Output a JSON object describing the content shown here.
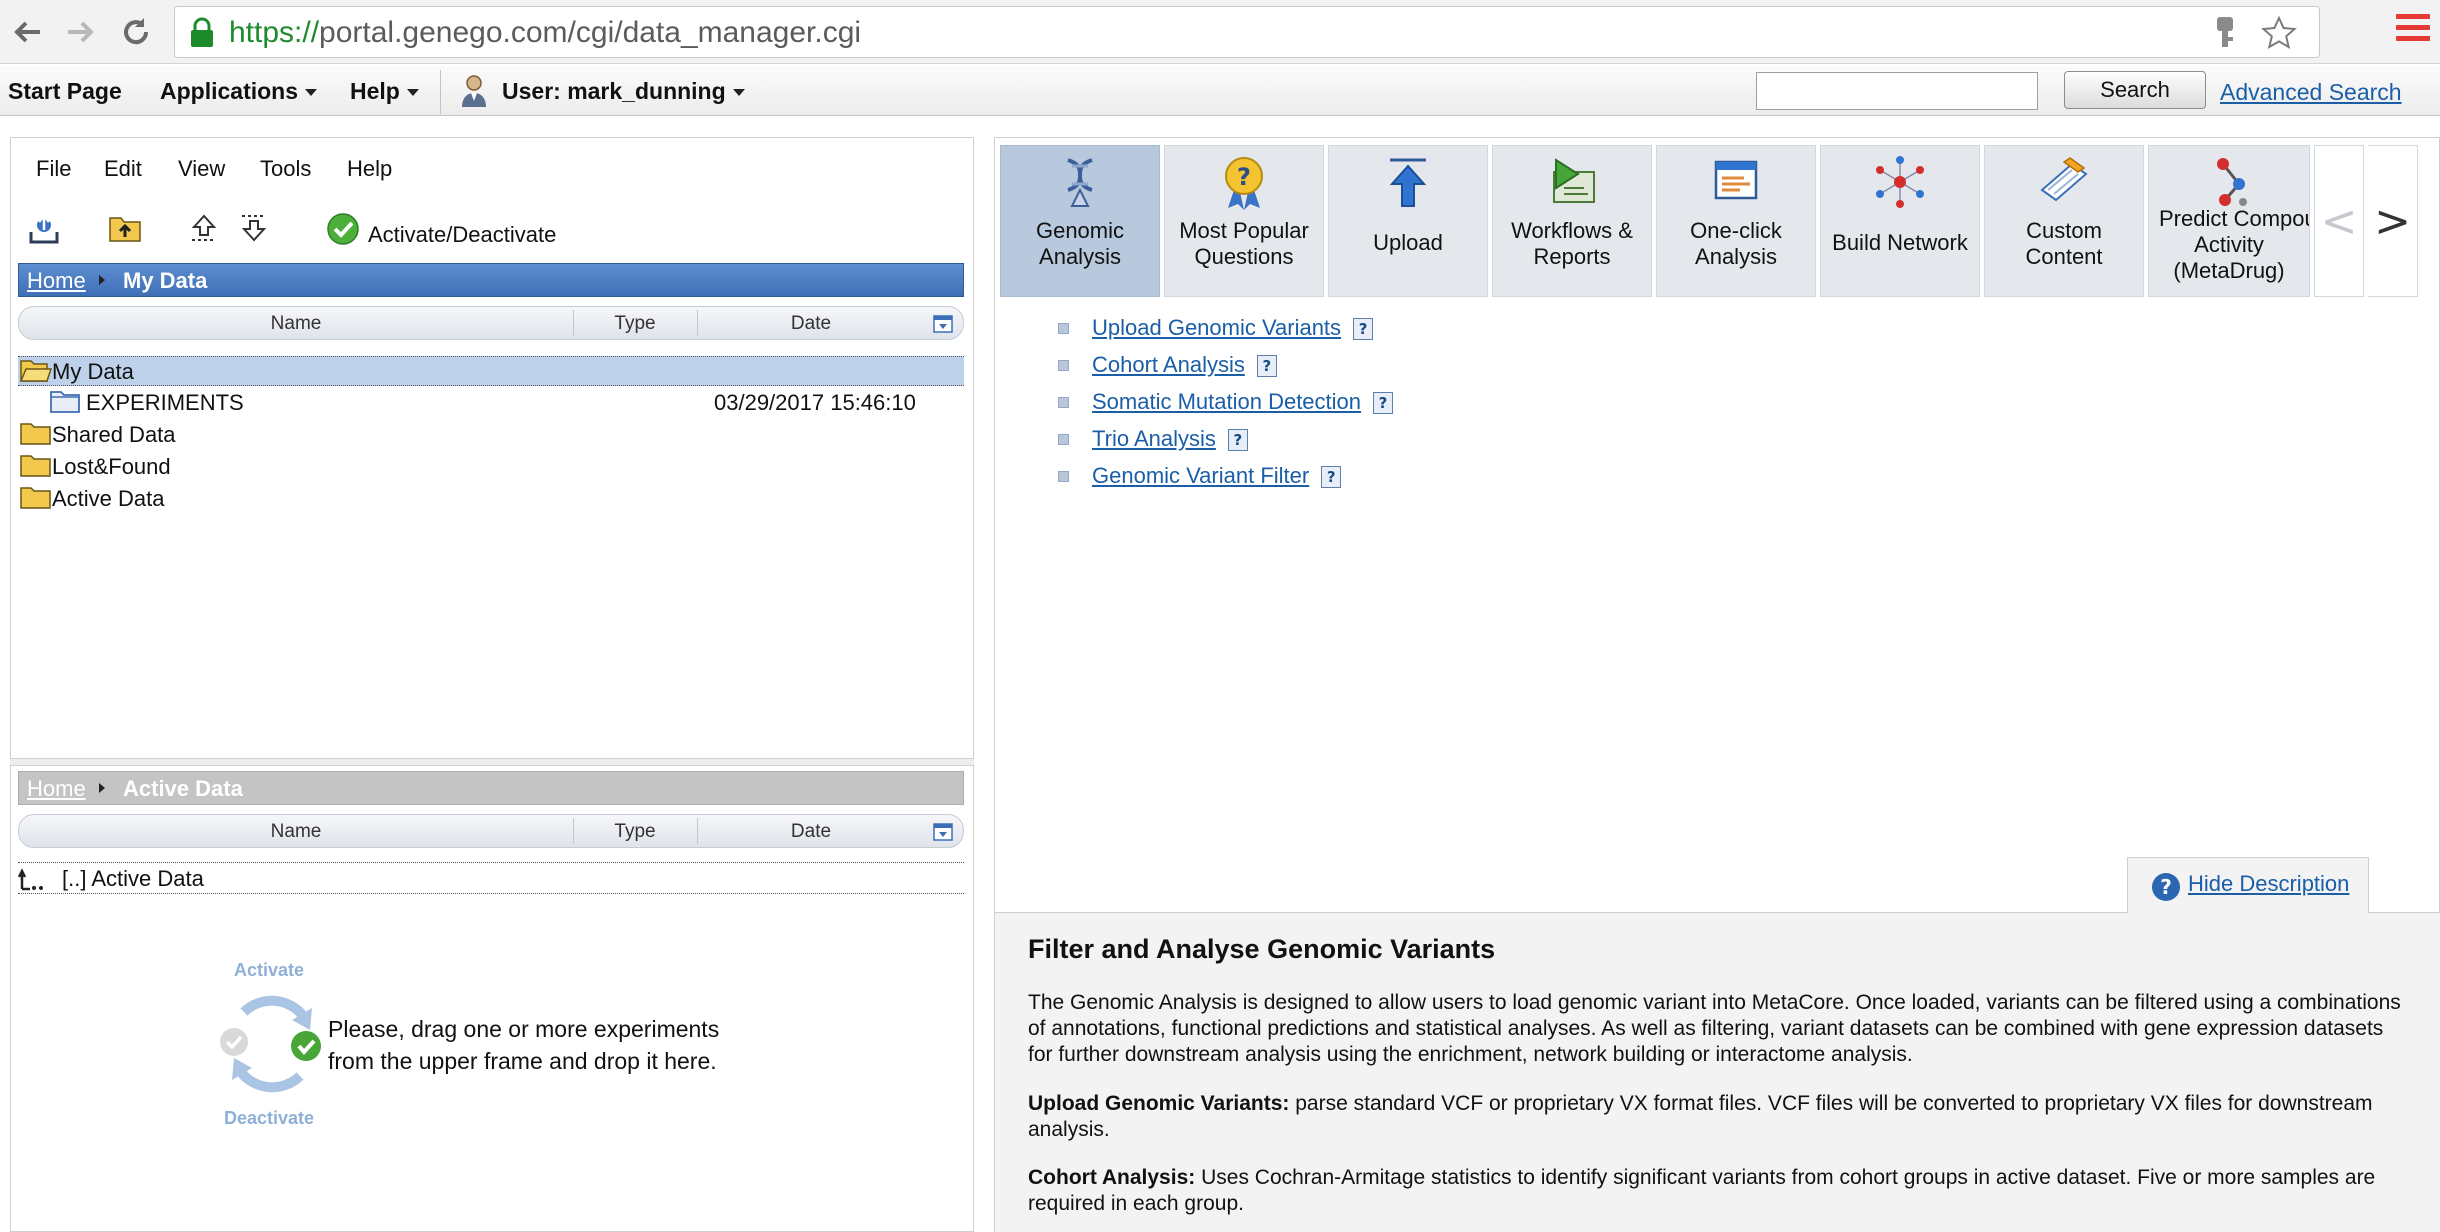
{
  "browser": {
    "url_scheme": "https://",
    "url_rest": "portal.genego.com/cgi/data_manager.cgi"
  },
  "app_bar": {
    "start_page": "Start Page",
    "applications": "Applications",
    "help": "Help",
    "user": "User: mark_dunning",
    "search_value": "",
    "search_button": "Search",
    "advanced_search": "Advanced Search"
  },
  "file_manager": {
    "menu": [
      "File",
      "Edit",
      "View",
      "Tools",
      "Help"
    ],
    "activate_label": "Activate/Deactivate",
    "breadcrumb_home": "Home",
    "breadcrumb_current": "My Data",
    "columns": {
      "name": "Name",
      "type": "Type",
      "date": "Date"
    },
    "tree": [
      {
        "label": "My Data",
        "type": "",
        "date": ""
      },
      {
        "label": "EXPERIMENTS",
        "type": "",
        "date": "03/29/2017 15:46:10"
      },
      {
        "label": "Shared Data",
        "type": "",
        "date": ""
      },
      {
        "label": "Lost&Found",
        "type": "",
        "date": ""
      },
      {
        "label": "Active Data",
        "type": "",
        "date": ""
      }
    ]
  },
  "active_data": {
    "breadcrumb_home": "Home",
    "breadcrumb_current": "Active Data",
    "columns": {
      "name": "Name",
      "type": "Type",
      "date": "Date"
    },
    "row_label": "[..] Active Data",
    "graphic_top": "Activate",
    "graphic_bottom": "Deactivate",
    "hint_line1": "Please, drag one or more experiments",
    "hint_line2": "from the upper frame and drop it here."
  },
  "tabs": [
    {
      "line1": "Genomic",
      "line2": "Analysis",
      "line3": "",
      "icon": "dna-icon",
      "active": true
    },
    {
      "line1": "Most Popular",
      "line2": "Questions",
      "line3": "",
      "icon": "question-medal-icon",
      "active": false
    },
    {
      "line1": "Upload",
      "line2": "",
      "line3": "",
      "icon": "upload-arrow-icon",
      "active": false
    },
    {
      "line1": "Workflows &",
      "line2": "Reports",
      "line3": "",
      "icon": "workflow-play-icon",
      "active": false
    },
    {
      "line1": "One-click",
      "line2": "Analysis",
      "line3": "",
      "icon": "one-click-window-icon",
      "active": false
    },
    {
      "line1": "Build Network",
      "line2": "",
      "line3": "",
      "icon": "network-icon",
      "active": false
    },
    {
      "line1": "Custom",
      "line2": "Content",
      "line3": "",
      "icon": "custom-content-icon",
      "active": false
    },
    {
      "line1": "Predict Compou",
      "line2": "Activity",
      "line3": "(MetaDrug)",
      "icon": "molecule-icon",
      "active": false
    }
  ],
  "tool_links": [
    "Upload Genomic Variants",
    "Cohort Analysis",
    "Somatic Mutation Detection",
    "Trio Analysis",
    "Genomic Variant Filter"
  ],
  "description": {
    "hide_link": "Hide Description",
    "title": "Filter and Analyse Genomic Variants",
    "intro": "The Genomic Analysis is designed to allow users to load genomic variant into MetaCore. Once loaded, variants can be filtered using a combinations of annotations, functional predictions and statistical analyses. As well as filtering, variant datasets can be combined with gene expression datasets for further downstream analysis using the enrichment, network building or interactome analysis.",
    "upload_term": "Upload Genomic Variants:",
    "upload_text": "parse standard VCF or proprietary VX format files. VCF files will be converted to proprietary VX files for downstream analysis.",
    "cohort_term": "Cohort Analysis:",
    "cohort_text": "Uses Cochran-Armitage statistics to identify significant variants from cohort groups in active dataset. Five or more samples are required in each group."
  },
  "colors": {
    "link": "#1a5ea8",
    "breadcrumb_blue": "#4a7cc0",
    "active_tab": "#b8c9dd",
    "tab": "#e4e8ec"
  }
}
